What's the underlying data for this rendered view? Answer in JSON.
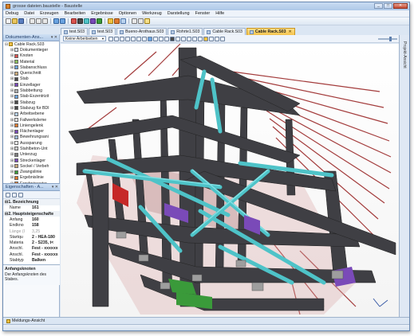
{
  "window": {
    "title": "grosse dateien.baustelle - Baustelle"
  },
  "menu": [
    "Debug",
    "Datei",
    "Erzeugen",
    "Bearbeiten",
    "Ergebnisse",
    "Optionen",
    "Werkzeug",
    "Darstellung",
    "Fenster",
    "Hilfe"
  ],
  "navigator": {
    "title": "Dokumenten-Ans...",
    "root": "Cable Rack.S03",
    "items": [
      "Dokumentieger",
      "Knoten",
      "Material",
      "Stabanschluss",
      "Querschnitt",
      "Stab",
      "Einzellager",
      "Stabbettung",
      "Stab-Exzentrizit",
      "Stabzug",
      "Stabzug für BDI",
      "Arbeitsebene",
      "Fallwerksleme",
      "Liniengelenk",
      "Flächenlager",
      "Bewehrungsani",
      "Aussparung",
      "Stahlbeton-Unt",
      "Unterzug",
      "Streckenlager",
      "Sockel / Verbeh",
      "Zwangslinie",
      "Ergebnislinie",
      "Ergebnisraster",
      "Lastfall"
    ]
  },
  "properties": {
    "title": "Eigenschaften - A...",
    "sections": [
      {
        "name": "1. Bezeichnung",
        "rows": [
          {
            "key": "Name",
            "value": "161",
            "dim": false
          }
        ]
      },
      {
        "name": "2. Hauptsteigenschafte",
        "rows": [
          {
            "key": "Anfang",
            "value": "160",
            "dim": false
          },
          {
            "key": "Endkno",
            "value": "158",
            "dim": false
          },
          {
            "key": "Länge (I",
            "value": "3,25",
            "dim": true
          },
          {
            "key": "Startqu",
            "value": "2 - HEA-180",
            "dim": false
          },
          {
            "key": "Materia",
            "value": "2 - S235, t<",
            "dim": false
          },
          {
            "key": "Anschl.",
            "value": "Fest - xxxxxx",
            "dim": false
          },
          {
            "key": "Anschl.",
            "value": "Fest - xxxxxx",
            "dim": false
          },
          {
            "key": "Stabtyp",
            "value": "Balken",
            "dim": false
          }
        ]
      }
    ],
    "help_title": "Anfangsknoten",
    "help_text": "Der Anfangsknoten des Stabes."
  },
  "tabs": [
    {
      "label": "test.S03",
      "active": false
    },
    {
      "label": "test.S03",
      "active": false
    },
    {
      "label": "Bueno-Arothaus.S03",
      "active": false
    },
    {
      "label": "Rohrte1.S03",
      "active": false
    },
    {
      "label": "Cable Rack.S03",
      "active": false
    },
    {
      "label": "Cable Rack.S03",
      "active": true
    }
  ],
  "view_toolbar": {
    "work_plane": "Keine Arbeitseben"
  },
  "right_panel": {
    "label": "Projekt-Ansicht"
  },
  "bottom_panel": {
    "label": "Meldungs-Ansicht"
  },
  "colors": {
    "steel_dark": "#3f3f44",
    "bracing_cyan": "#4ec3c8",
    "purple": "#7a4ab8",
    "red": "#c62828",
    "green": "#3a9a3a",
    "active_tab": "#f5c24b"
  },
  "icons": {
    "app": "app-icon",
    "minimize": "minimize-icon",
    "maximize": "maximize-icon",
    "close": "close-icon"
  }
}
